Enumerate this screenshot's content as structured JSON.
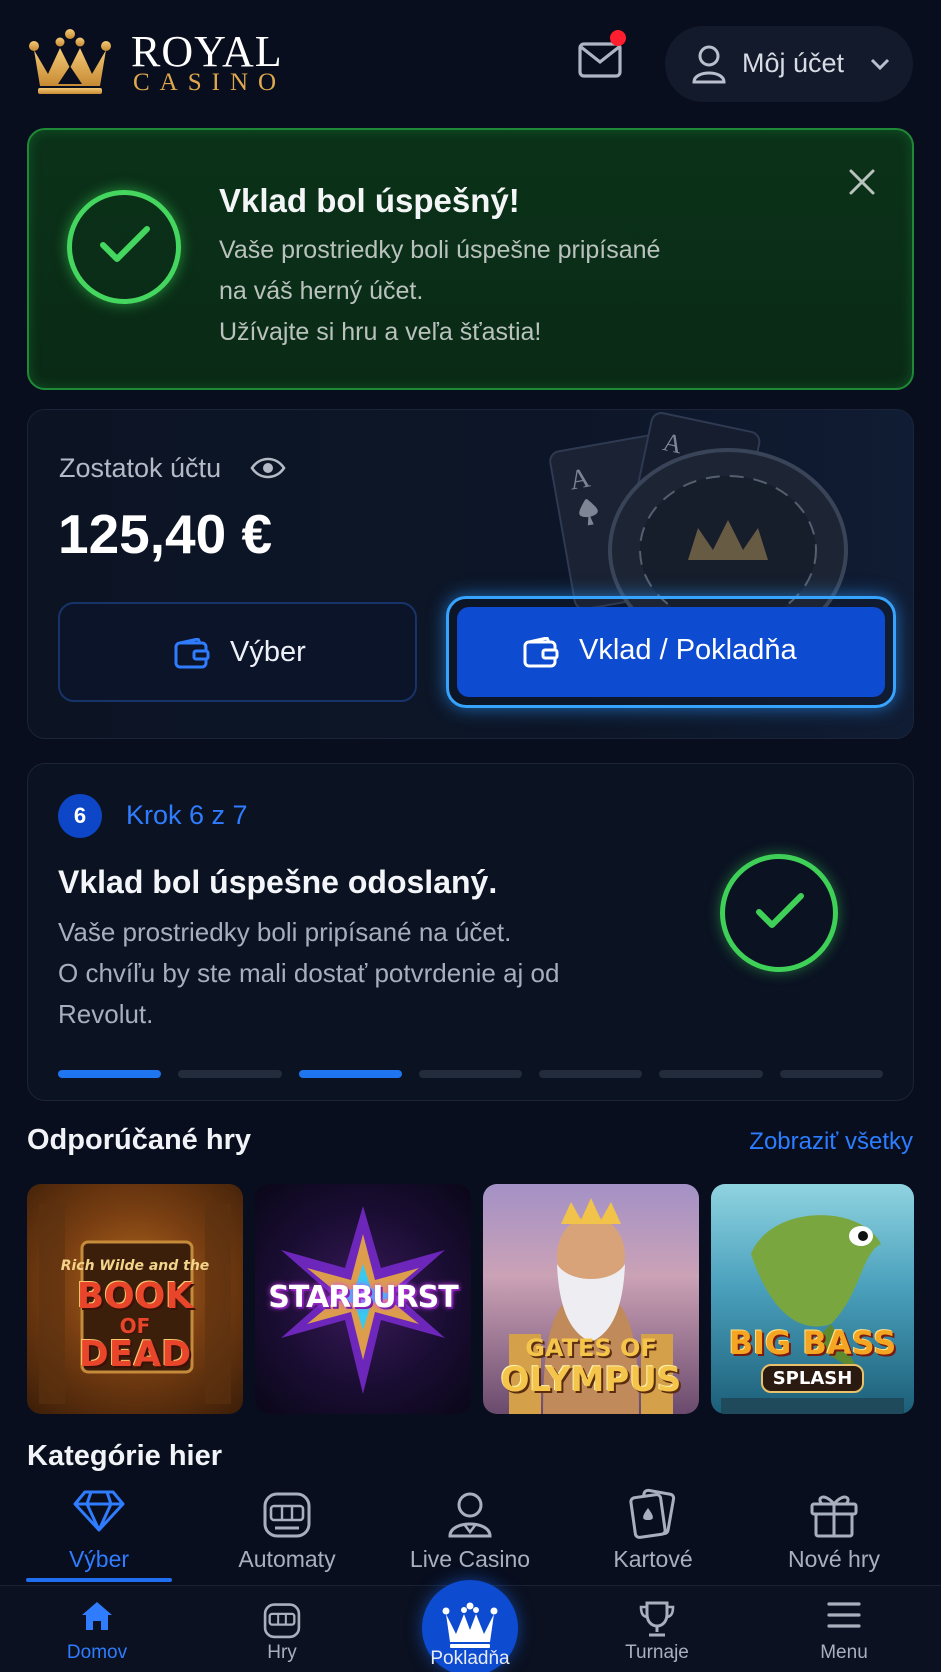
{
  "header": {
    "logo_top": "ROYAL",
    "logo_bottom": "CASINO",
    "account_label": "Môj účet",
    "has_notification": true
  },
  "success": {
    "title": "Vklad bol úspešný!",
    "line1": "Vaše prostriedky boli úspešne pripísané",
    "line2": "na váš herný účet.",
    "line3": "Užívajte si hru a veľa šťastia!"
  },
  "balance": {
    "label": "Zostatok účtu",
    "amount": "125,40 €",
    "withdraw_label": "Výber",
    "deposit_label": "Vklad / Pokladňa"
  },
  "step": {
    "number": "6",
    "counter": "Krok 6 z 7",
    "title": "Vklad bol úspešne odoslaný.",
    "line1": "Vaše prostriedky boli pripísané na účet.",
    "line2": "O chvíľu by ste mali dostať potvrdenie aj od",
    "line3": "Revolut.",
    "progress_segments": [
      true,
      false,
      true,
      false,
      false,
      false,
      false
    ]
  },
  "recommended": {
    "title": "Odporúčané hry",
    "view_all": "Zobraziť všetky",
    "games": [
      {
        "top": "Rich Wilde and the",
        "name1": "BOOK",
        "name2": "OF",
        "name3": "DEAD"
      },
      {
        "name1": "STARBURST"
      },
      {
        "name1": "GATES OF",
        "name2": "OLYMPUS"
      },
      {
        "name1": "BIG BASS",
        "name2": "SPLASH"
      }
    ]
  },
  "categories": {
    "title": "Kategórie hier",
    "items": [
      {
        "label": "Výber",
        "icon": "diamond-icon",
        "active": true
      },
      {
        "label": "Automaty",
        "icon": "slot-machine-icon",
        "active": false
      },
      {
        "label": "Live Casino",
        "icon": "dealer-icon",
        "active": false
      },
      {
        "label": "Kartové",
        "icon": "cards-icon",
        "active": false
      },
      {
        "label": "Nové hry",
        "icon": "gift-icon",
        "active": false
      }
    ]
  },
  "bottom_nav": {
    "items": [
      {
        "label": "Domov",
        "icon": "home-icon",
        "active": true
      },
      {
        "label": "Hry",
        "icon": "slot-machine-icon",
        "active": false
      },
      {
        "label": "Pokladňa",
        "icon": "crown-icon",
        "active": false
      },
      {
        "label": "Turnaje",
        "icon": "trophy-icon",
        "active": false
      },
      {
        "label": "Menu",
        "icon": "menu-icon",
        "active": false
      }
    ]
  },
  "colors": {
    "background": "#080e1e",
    "accent_blue": "#0d4bd0",
    "success_green": "#44d65e",
    "gold": "#e0a84c"
  }
}
